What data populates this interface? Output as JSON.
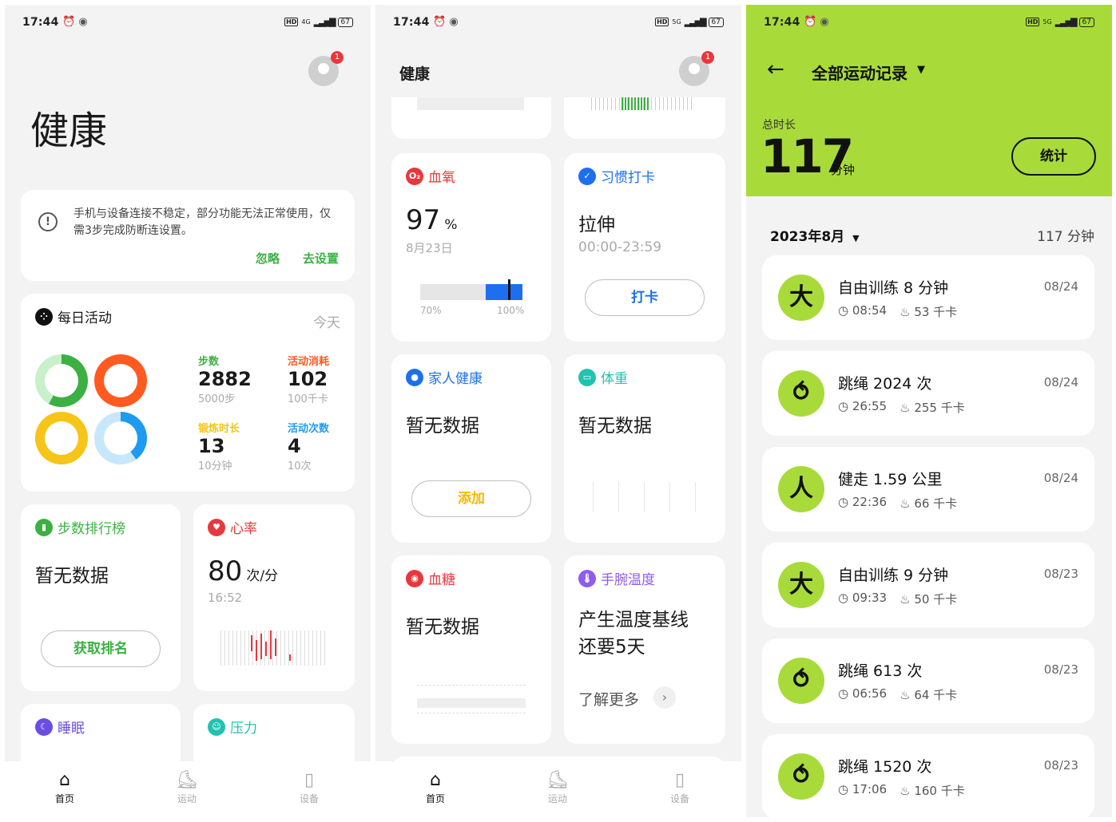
{
  "panel1": {
    "status": {
      "time": "17:44",
      "net": "4G",
      "battery": "67"
    },
    "avatar_badge": "1",
    "title": "健康",
    "notice": {
      "text": "手机与设备连接不稳定，部分功能无法正常使用，仅需3步完成防断连设置。",
      "ignore": "忽略",
      "setup": "去设置"
    },
    "daily": {
      "title": "每日活动",
      "period": "今天",
      "steps": {
        "label": "步数",
        "value": "2882",
        "goal": "5000步"
      },
      "calories": {
        "label": "活动消耗",
        "value": "102",
        "goal": "100千卡"
      },
      "exercise": {
        "label": "锻炼时长",
        "value": "13",
        "goal": "10分钟"
      },
      "activity": {
        "label": "活动次数",
        "value": "4",
        "goal": "10次"
      }
    },
    "ranking": {
      "title": "步数排行榜",
      "empty": "暂无数据",
      "button": "获取排名"
    },
    "heart": {
      "title": "心率",
      "value": "80",
      "unit": "次/分",
      "time": "16:52"
    },
    "sleep": {
      "title": "睡眠"
    },
    "stress": {
      "title": "压力"
    },
    "nav": [
      {
        "label": "首页"
      },
      {
        "label": "运动"
      },
      {
        "label": "设备"
      }
    ]
  },
  "panel2": {
    "status": {
      "time": "17:44",
      "net": "5G",
      "battery": "67"
    },
    "header_title": "健康",
    "avatar_badge": "1",
    "spo2": {
      "title": "血氧",
      "value": "97",
      "unit": "%",
      "date": "8月23日",
      "low": "70%",
      "high": "100%"
    },
    "habit": {
      "title": "习惯打卡",
      "name": "拉伸",
      "time": "00:00-23:59",
      "button": "打卡"
    },
    "family": {
      "title": "家人健康",
      "empty": "暂无数据",
      "button": "添加"
    },
    "weight": {
      "title": "体重",
      "empty": "暂无数据"
    },
    "glucose": {
      "title": "血糖",
      "empty": "暂无数据"
    },
    "wrist": {
      "title": "手腕温度",
      "text": "产生温度基线还要5天",
      "more": "了解更多"
    },
    "nav": [
      {
        "label": "首页"
      },
      {
        "label": "运动"
      },
      {
        "label": "设备"
      }
    ]
  },
  "panel3": {
    "status": {
      "time": "17:44",
      "net": "5G",
      "battery": "67"
    },
    "title": "全部运动记录",
    "total_label": "总时长",
    "total_value": "117",
    "total_unit": "分钟",
    "stats_button": "统计",
    "month": "2023年8月",
    "month_total": "117 分钟",
    "records": [
      {
        "title": "自由训练 8 分钟",
        "time": "08:54",
        "kcal": "53 千卡",
        "date": "08/24",
        "icon": "person-icon"
      },
      {
        "title": "跳绳 2024 次",
        "time": "26:55",
        "kcal": "255 千卡",
        "date": "08/24",
        "icon": "jump-rope-icon"
      },
      {
        "title": "健走 1.59 公里",
        "time": "22:36",
        "kcal": "66 千卡",
        "date": "08/24",
        "icon": "walking-icon"
      },
      {
        "title": "自由训练 9 分钟",
        "time": "09:33",
        "kcal": "50 千卡",
        "date": "08/23",
        "icon": "person-icon"
      },
      {
        "title": "跳绳 613 次",
        "time": "06:56",
        "kcal": "64 千卡",
        "date": "08/23",
        "icon": "jump-rope-icon"
      },
      {
        "title": "跳绳 1520 次",
        "time": "17:06",
        "kcal": "160 千卡",
        "date": "08/23",
        "icon": "jump-rope-icon"
      }
    ]
  },
  "colors": {
    "green": "#3cb043",
    "accent_lime": "#a8db3a",
    "red": "#e8383d",
    "orange": "#ff5a1f",
    "yellow": "#f5c518",
    "blue": "#1e9bf0",
    "indigo": "#4a6cf7"
  }
}
